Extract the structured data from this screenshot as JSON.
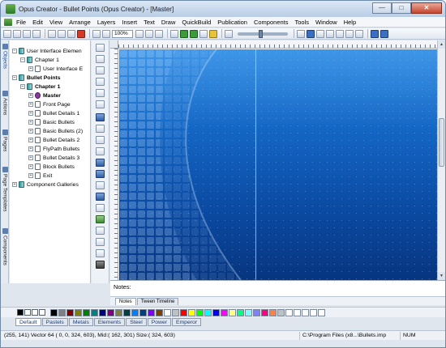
{
  "window": {
    "title": "Opus Creator - Bullet Points (Opus Creator) - [Master]",
    "controls": {
      "minimize": "—",
      "maximize": "□",
      "close": "✕"
    }
  },
  "menu": [
    "File",
    "Edit",
    "View",
    "Arrange",
    "Layers",
    "Insert",
    "Text",
    "Draw",
    "QuickBuild",
    "Publication",
    "Components",
    "Tools",
    "Window",
    "Help"
  ],
  "toolbar": {
    "zoom": "100%"
  },
  "left_tabs": [
    "Objects",
    "Actions",
    "Pages",
    "Page Templates",
    "Components"
  ],
  "tree": [
    {
      "label": "User Interface Elemen",
      "expander": "−",
      "icon": "book",
      "bold": false
    },
    {
      "label": "Chapter 1",
      "expander": "−",
      "icon": "book",
      "bold": false
    },
    {
      "label": "User Interface E",
      "expander": "+",
      "icon": "page",
      "bold": false
    },
    {
      "label": "Bullet Points",
      "expander": "−",
      "icon": "book",
      "bold": true
    },
    {
      "label": "Chapter 1",
      "expander": "−",
      "icon": "book",
      "bold": true
    },
    {
      "label": "Master",
      "expander": "+",
      "icon": "gear",
      "bold": true
    },
    {
      "label": "Front Page",
      "expander": "+",
      "icon": "page",
      "bold": false
    },
    {
      "label": "Bullet Details 1",
      "expander": "+",
      "icon": "page",
      "bold": false
    },
    {
      "label": "Basic Bullets",
      "expander": "+",
      "icon": "page",
      "bold": false
    },
    {
      "label": "Basic Bullets (2)",
      "expander": "+",
      "icon": "page",
      "bold": false
    },
    {
      "label": "Bullet Details 2",
      "expander": "+",
      "icon": "page",
      "bold": false
    },
    {
      "label": "FlyPath Bullets",
      "expander": "+",
      "icon": "page",
      "bold": false
    },
    {
      "label": "Bullet Details 3",
      "expander": "+",
      "icon": "page",
      "bold": false
    },
    {
      "label": "Block Bullets",
      "expander": "+",
      "icon": "page",
      "bold": false
    },
    {
      "label": "Exit",
      "expander": "+",
      "icon": "page",
      "bold": false
    },
    {
      "label": "Component Galleries",
      "expander": "+",
      "icon": "book",
      "bold": false
    }
  ],
  "notes": {
    "label": "Notes:",
    "tabs": [
      "Notes",
      "Tween Timeline"
    ]
  },
  "palette": {
    "colors": [
      "#000000",
      "#808080",
      "#800000",
      "#808000",
      "#008000",
      "#008080",
      "#000080",
      "#800080",
      "#808040",
      "#004040",
      "#0080ff",
      "#004080",
      "#8000ff",
      "#804000",
      "#ffffff",
      "#c0c0c0",
      "#ff0000",
      "#ffff00",
      "#00ff00",
      "#00ffff",
      "#0000ff",
      "#ff00ff",
      "#ffff80",
      "#00ff80",
      "#80ffff",
      "#8080ff",
      "#ff0080",
      "#ff8040",
      "#c0c0c0",
      "#ffffff",
      "#ffffff",
      "#ffffff",
      "#ffffff",
      "#ffffff"
    ],
    "tabs": [
      "Default",
      "Pastels",
      "Metals",
      "Elements",
      "Steel",
      "Power",
      "Emperor"
    ]
  },
  "status": {
    "left": "(255,  141) Vector 64 (   0,   0, 324,  603), Mid:( 162, 301) Size:( 324,  603)",
    "path": "C:\\Program Files (x8...\\Bullets.imp",
    "num": "NUM"
  },
  "colors": {
    "canvas_top": "#3f97e8",
    "canvas_bottom": "#07357f",
    "accent": "#1c4fa0"
  }
}
